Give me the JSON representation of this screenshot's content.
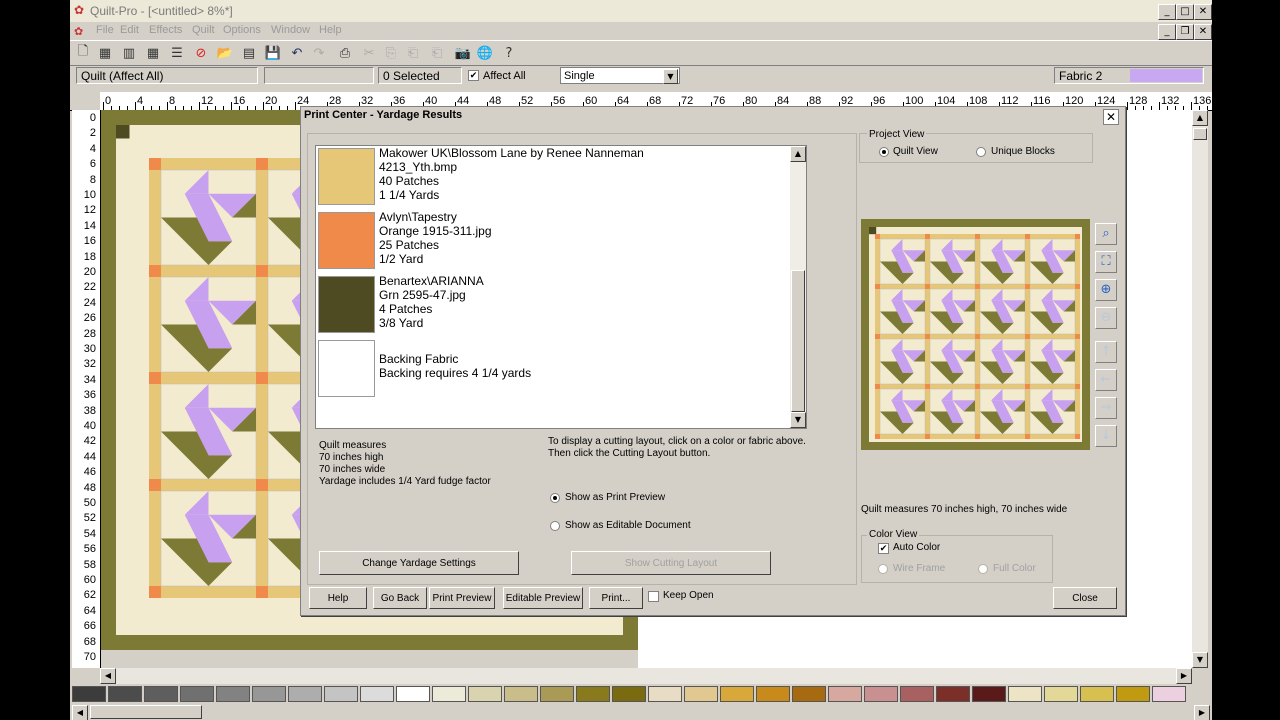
{
  "window": {
    "title": "Quilt-Pro - [<untitled> 8%*]",
    "buttons": {
      "minimize": "_",
      "maximize": "□",
      "close": "✕"
    }
  },
  "menu": [
    "File",
    "Edit",
    "Effects",
    "Quilt",
    "Options",
    "Window",
    "Help"
  ],
  "toolbar": {
    "icons": [
      "new-icon",
      "grid-add-icon",
      "grid-icon",
      "block-icon",
      "layout-icon",
      "no-fabric-icon",
      "open-icon",
      "palette-icon",
      "save-icon",
      "undo-icon",
      "redo-icon",
      "print-icon",
      "cut-icon",
      "copy-icon",
      "paste-icon",
      "paste-special-icon",
      "camera-icon",
      "globe-icon",
      "help-icon"
    ]
  },
  "status": {
    "mode": "Quilt (Affect All)",
    "selected": "0 Selected",
    "affect_all_label": "Affect All",
    "affect_all_checked": true,
    "select_mode": "Single",
    "fabric_label": "Fabric 2",
    "fabric_color": "#c8a8f0"
  },
  "ruler": {
    "h_labels": [
      "0",
      "4",
      "8",
      "12",
      "16",
      "20",
      "24",
      "28",
      "32",
      "36",
      "40",
      "44",
      "48",
      "52",
      "56",
      "60",
      "64",
      "68",
      "72",
      "76",
      "80",
      "84",
      "88",
      "92",
      "96",
      "100",
      "104",
      "108",
      "112",
      "116",
      "120",
      "124",
      "128",
      "132",
      "136"
    ],
    "v_labels": [
      "0",
      "2",
      "4",
      "6",
      "8",
      "10",
      "12",
      "14",
      "16",
      "18",
      "20",
      "22",
      "24",
      "26",
      "28",
      "30",
      "32",
      "34",
      "36",
      "38",
      "40",
      "42",
      "44",
      "46",
      "48",
      "50",
      "52",
      "54",
      "56",
      "58",
      "60",
      "62",
      "64",
      "66",
      "68",
      "70"
    ]
  },
  "palette_colors": [
    "#3c3c3c",
    "#4c4c4c",
    "#5e5e5e",
    "#707070",
    "#828282",
    "#979797",
    "#adadad",
    "#c4c4c4",
    "#dcdcdc",
    "#ffffff",
    "#ecebd9",
    "#d9d3b0",
    "#c9bd8a",
    "#a99a55",
    "#8a7a1e",
    "#7a6a10",
    "#e8dcc4",
    "#e0c890",
    "#d9a83a",
    "#c88a1a",
    "#a86a10",
    "#d6a8a0",
    "#c89090",
    "#a86060",
    "#7c2e28",
    "#5a1a1a",
    "#ece4c4",
    "#e4d898",
    "#d8c050",
    "#c09a10",
    "#ecd0e0"
  ],
  "dialog": {
    "title": "Print Center - Yardage Results",
    "close_glyph": "✕",
    "fabrics": [
      {
        "color": "#e6c677",
        "lines": [
          "Makower UK\\Blossom Lane by Renee Nanneman",
          "4213_Yth.bmp",
          "40 Patches",
          "1 1/4 Yards"
        ]
      },
      {
        "color": "#f08a4a",
        "lines": [
          "Avlyn\\Tapestry",
          "Orange 1915-311.jpg",
          "25 Patches",
          "1/2 Yard"
        ]
      },
      {
        "color": "#4e4b22",
        "lines": [
          "Benartex\\ARIANNA",
          "Grn 2595-47.jpg",
          "4 Patches",
          "3/8 Yard"
        ]
      },
      {
        "color": "#ffffff",
        "lines": [
          "Backing Fabric",
          "Backing requires 4 1/4 yards"
        ]
      }
    ],
    "quilt_measures": [
      "Quilt measures",
      "70 inches high",
      "70 inches wide",
      "Yardage includes 1/4 Yard fudge factor"
    ],
    "cutting_hint": [
      "To display a cutting layout, click on a color or fabric above.",
      "Then click the Cutting Layout button."
    ],
    "show_print_preview": "Show as Print Preview",
    "show_editable": "Show as Editable Document",
    "change_settings": "Change Yardage Settings",
    "show_cutting": "Show Cutting Layout",
    "project_view": {
      "label": "Project View",
      "quilt_view": "Quilt View",
      "unique_blocks": "Unique Blocks"
    },
    "measures_summary": "Quilt measures 70 inches high, 70 inches wide",
    "color_view": {
      "label": "Color View",
      "auto_color": "Auto Color",
      "wire_frame": "Wire Frame",
      "full_color": "Full Color"
    },
    "buttons": {
      "help": "Help",
      "go_back": "Go Back",
      "print_preview": "Print Preview",
      "editable_preview": "Editable Preview",
      "print": "Print...",
      "keep_open": "Keep Open",
      "close": "Close"
    },
    "view_tools": [
      "zoom-icon",
      "fit-icon",
      "zoom-in-icon",
      "zoom-out-icon",
      "up-arrow-icon",
      "left-arrow-icon",
      "right-arrow-icon",
      "down-arrow-icon"
    ]
  }
}
